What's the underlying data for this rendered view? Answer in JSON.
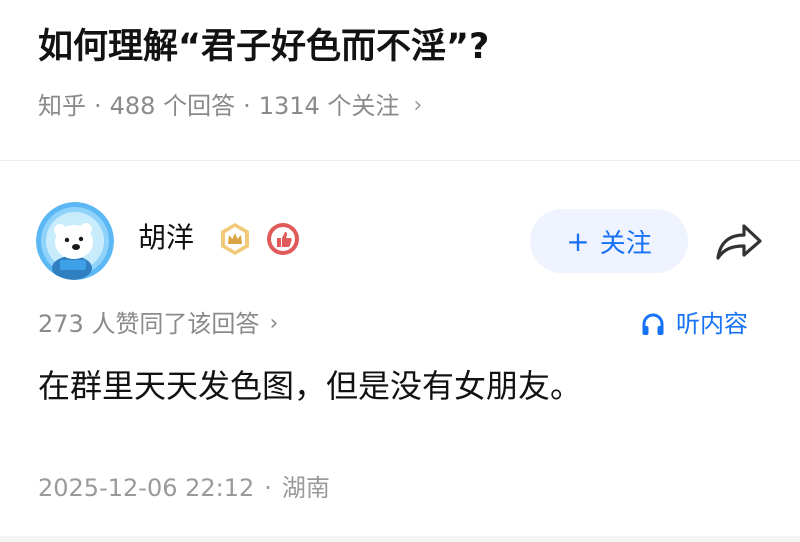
{
  "question": {
    "title": "如何理解“君子好色而不淫”?",
    "source": "知乎",
    "separator": "·",
    "answers": "488 个回答",
    "followers": "1314 个关注",
    "chevron": "›"
  },
  "answer": {
    "author": {
      "name": "胡洋",
      "avatar_icon": "polar-bear-avatar-icon",
      "badges": [
        "crown-badge-icon",
        "thumbs-up-badge-icon"
      ]
    },
    "follow_button": {
      "plus": "+",
      "label": "关注"
    },
    "share_icon": "share-arrow-icon",
    "likes_text": "273 人赞同了该回答",
    "likes_chevron": "›",
    "listen": {
      "icon": "headphones-icon",
      "label": "听内容"
    },
    "content": "在群里天天发色图，但是没有女朋友。",
    "time": "2025-12-06 22:12",
    "separator": "·",
    "location": "湖南"
  },
  "colors": {
    "accent": "#1772f6",
    "follow_bg": "#eef3ff",
    "meta_gray": "#8a8a8a",
    "text": "#121212",
    "crown_badge": "#d9a441",
    "like_badge": "#e05a5a"
  }
}
